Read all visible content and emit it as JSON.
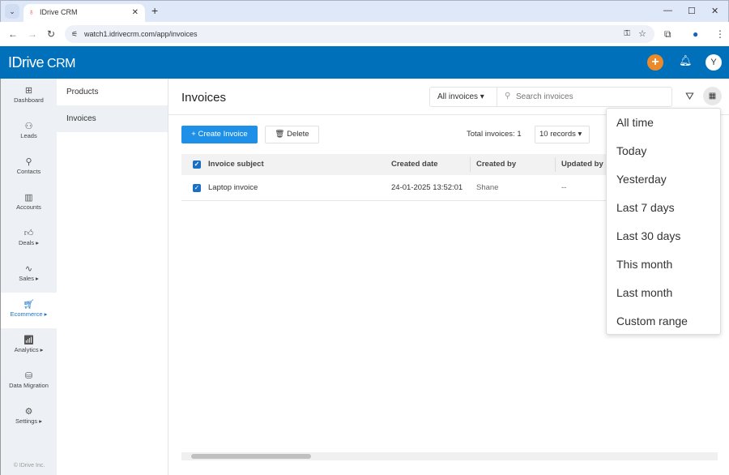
{
  "browser": {
    "tab_title": "IDrive CRM",
    "url": "watch1.idrivecrm.com/app/invoices"
  },
  "app": {
    "logo": "IDrive",
    "logo_suffix": "CRM",
    "avatar_initial": "Y",
    "brand_color": "#0070bb"
  },
  "sidebar": {
    "items": [
      {
        "label": "Dashboard",
        "icon": "dashboard-icon"
      },
      {
        "label": "Leads",
        "icon": "leads-icon"
      },
      {
        "label": "Contacts",
        "icon": "contacts-icon"
      },
      {
        "label": "Accounts",
        "icon": "accounts-icon"
      },
      {
        "label": "Deals ▸",
        "icon": "thumbs-up-icon"
      },
      {
        "label": "Sales ▸",
        "icon": "pulse-icon"
      },
      {
        "label": "Ecommerce ▸",
        "icon": "cart-icon",
        "active": true
      },
      {
        "label": "Analytics ▸",
        "icon": "chart-icon"
      },
      {
        "label": "Data Migration",
        "icon": "database-icon"
      },
      {
        "label": "Settings ▸",
        "icon": "gear-icon"
      }
    ],
    "copyright": "© IDrive Inc."
  },
  "submenu": {
    "items": [
      {
        "label": "Products"
      },
      {
        "label": "Invoices",
        "active": true
      }
    ]
  },
  "main": {
    "title": "Invoices",
    "view_select": "All invoices",
    "search_placeholder": "Search invoices",
    "create_label": "Create Invoice",
    "delete_label": "Delete",
    "total_label": "Total invoices:",
    "total_value": "1",
    "records_select": "10 records"
  },
  "table": {
    "columns": [
      "Invoice subject",
      "Created date",
      "Created by",
      "Updated by"
    ],
    "rows": [
      {
        "subject": "Laptop invoice",
        "created_date": "24-01-2025 13:52:01",
        "created_by": "Shane",
        "updated_by": "--"
      }
    ]
  },
  "date_menu": {
    "options": [
      "All time",
      "Today",
      "Yesterday",
      "Last 7 days",
      "Last 30 days",
      "This month",
      "Last month",
      "Custom range"
    ]
  }
}
